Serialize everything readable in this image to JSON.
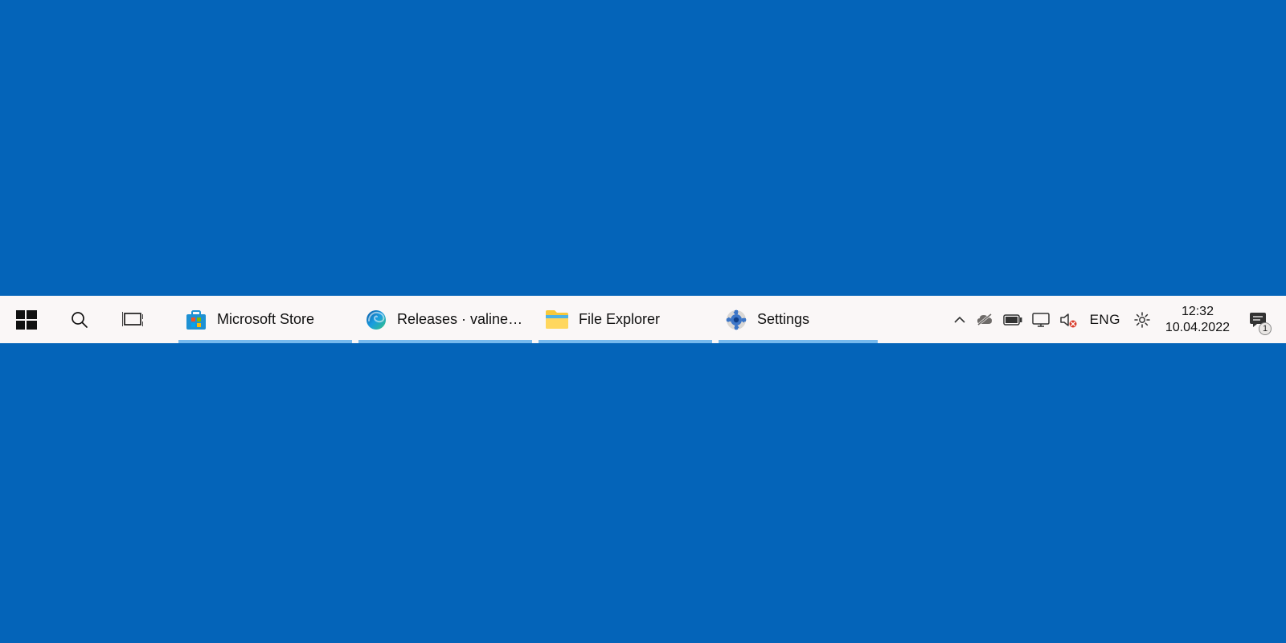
{
  "desktop": {
    "background": "#0464b9"
  },
  "taskbar": {
    "background": "#faf7f7",
    "apps": [
      {
        "label": "Microsoft Store",
        "icon": "ms-store"
      },
      {
        "label": "Releases · valinet/...",
        "icon": "edge"
      },
      {
        "label": "File Explorer",
        "icon": "file-explorer"
      },
      {
        "label": "Settings",
        "icon": "settings"
      }
    ],
    "tray": {
      "language": "ENG",
      "time": "12:32",
      "date": "10.04.2022",
      "notification_count": "1"
    }
  }
}
